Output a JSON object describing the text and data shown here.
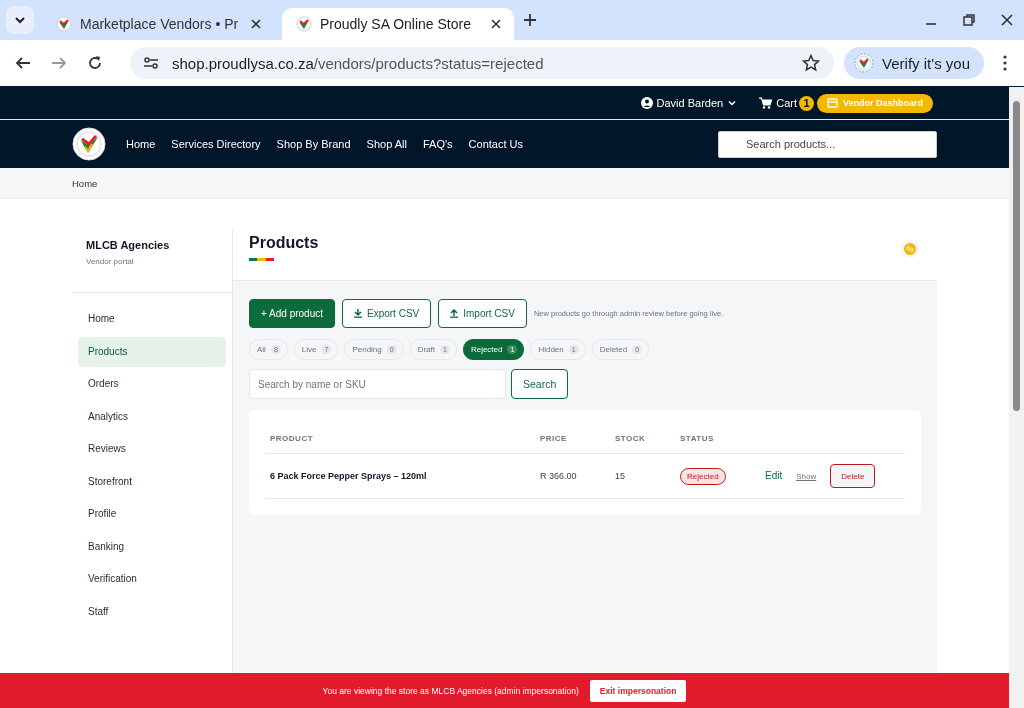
{
  "browser": {
    "tabs": [
      {
        "title": "Marketplace Vendors • Pr",
        "selected": false
      },
      {
        "title": "Proudly SA Online Store",
        "selected": true
      }
    ],
    "url_host": "shop.proudlysa.co.za",
    "url_path": "/vendors/products?status=rejected",
    "profile_label": "Verify it's you"
  },
  "topbar": {
    "user": "David Barden",
    "cart_label": "Cart",
    "cart_count": "1",
    "dashboard_label": "Vendor Dashboard"
  },
  "nav": {
    "items": [
      "Home",
      "Services Directory",
      "Shop By Brand",
      "Shop All",
      "FAQ's",
      "Contact Us"
    ],
    "search_placeholder": "Search products..."
  },
  "breadcrumb": [
    "Home"
  ],
  "sidebar": {
    "vendor": "MLCB Agencies",
    "subtitle": "Vendor portal",
    "items": [
      {
        "label": "Home",
        "selected": false
      },
      {
        "label": "Products",
        "selected": true
      },
      {
        "label": "Orders",
        "selected": false
      },
      {
        "label": "Analytics",
        "selected": false
      },
      {
        "label": "Reviews",
        "selected": false
      },
      {
        "label": "Storefront",
        "selected": false
      },
      {
        "label": "Profile",
        "selected": false
      },
      {
        "label": "Banking",
        "selected": false
      },
      {
        "label": "Verification",
        "selected": false
      },
      {
        "label": "Staff",
        "selected": false
      }
    ]
  },
  "main": {
    "title": "Products",
    "actions": [
      {
        "label": "+ Add product",
        "kind": "primary"
      },
      {
        "label": "Export CSV",
        "kind": "export"
      },
      {
        "label": "Import CSV",
        "kind": "import"
      }
    ],
    "note": "New products go through admin review before going live.",
    "filters": [
      {
        "label": "All",
        "count": "8",
        "selected": false
      },
      {
        "label": "Live",
        "count": "7",
        "selected": false
      },
      {
        "label": "Pending",
        "count": "0",
        "selected": false
      },
      {
        "label": "Draft",
        "count": "1",
        "selected": false
      },
      {
        "label": "Rejected",
        "count": "1",
        "selected": true
      },
      {
        "label": "Hidden",
        "count": "1",
        "selected": false
      },
      {
        "label": "Deleted",
        "count": "0",
        "selected": false
      }
    ],
    "search_placeholder": "Search by name or SKU",
    "search_button": "Search"
  },
  "table": {
    "columns": [
      "PRODUCT",
      "PRICE",
      "STOCK",
      "STATUS"
    ],
    "rows": [
      {
        "product": "6 Pack Force Pepper Sprays – 120ml",
        "price": "R 366.00",
        "stock": "15",
        "status": {
          "label": "Rejected",
          "kind": "rejected"
        },
        "actions": [
          {
            "label": "Edit",
            "kind": "edit"
          },
          {
            "label": "Show",
            "kind": "show"
          },
          {
            "label": "Delete",
            "kind": "delete"
          }
        ]
      }
    ]
  },
  "banner": {
    "text": "You are viewing the store as MLCB Agencies (admin impersonation)",
    "button": "Exit impersonation"
  }
}
